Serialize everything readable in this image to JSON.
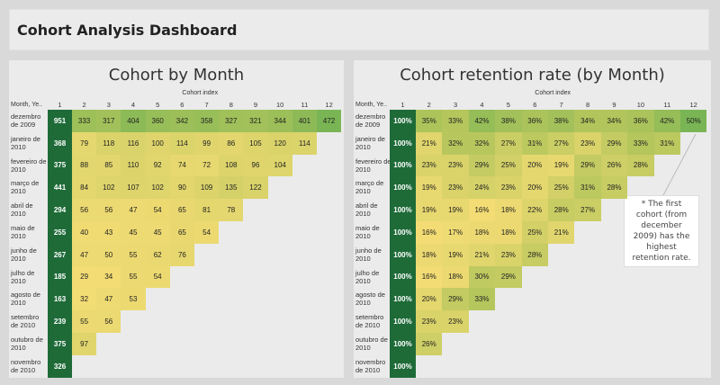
{
  "header": {
    "title": "Cohort Analysis Dashboard"
  },
  "colors": {
    "first_column": "#1e6b38",
    "high": "#7ab555",
    "mid_green": "#b4c65c",
    "low": "#f3dc74",
    "empty": "#ebebeb"
  },
  "axis": {
    "cohort_index_title": "Cohort index",
    "row_header": "Month, Ye..",
    "columns": [
      "1",
      "2",
      "3",
      "4",
      "5",
      "6",
      "7",
      "8",
      "9",
      "10",
      "11",
      "12"
    ]
  },
  "rows": [
    "dezembro de 2009",
    "janeiro de 2010",
    "fevereiro de 2010",
    "março de 2010",
    "abril de 2010",
    "maio de 2010",
    "junho de 2010",
    "julho de 2010",
    "agosto de 2010",
    "setembro de 2010",
    "outubro de 2010",
    "novembro de 2010"
  ],
  "left_panel": {
    "title": "Cohort by Month",
    "values": [
      [
        951,
        333,
        317,
        404,
        360,
        342,
        358,
        327,
        321,
        344,
        401,
        472
      ],
      [
        368,
        79,
        118,
        116,
        100,
        114,
        99,
        86,
        105,
        120,
        114
      ],
      [
        375,
        88,
        85,
        110,
        92,
        74,
        72,
        108,
        96,
        104
      ],
      [
        441,
        84,
        102,
        107,
        102,
        90,
        109,
        135,
        122
      ],
      [
        294,
        56,
        56,
        47,
        54,
        65,
        81,
        78
      ],
      [
        255,
        40,
        43,
        45,
        45,
        65,
        54
      ],
      [
        267,
        47,
        50,
        55,
        62,
        76
      ],
      [
        185,
        29,
        34,
        55,
        54
      ],
      [
        163,
        32,
        47,
        53
      ],
      [
        239,
        55,
        56
      ],
      [
        375,
        97
      ],
      [
        326
      ]
    ]
  },
  "right_panel": {
    "title": "Cohort retention rate (by Month)",
    "values": [
      [
        "100%",
        "35%",
        "33%",
        "42%",
        "38%",
        "36%",
        "38%",
        "34%",
        "34%",
        "36%",
        "42%",
        "50%"
      ],
      [
        "100%",
        "21%",
        "32%",
        "32%",
        "27%",
        "31%",
        "27%",
        "23%",
        "29%",
        "33%",
        "31%"
      ],
      [
        "100%",
        "23%",
        "23%",
        "29%",
        "25%",
        "20%",
        "19%",
        "29%",
        "26%",
        "28%"
      ],
      [
        "100%",
        "19%",
        "23%",
        "24%",
        "23%",
        "20%",
        "25%",
        "31%",
        "28%"
      ],
      [
        "100%",
        "19%",
        "19%",
        "16%",
        "18%",
        "22%",
        "28%",
        "27%"
      ],
      [
        "100%",
        "16%",
        "17%",
        "18%",
        "18%",
        "25%",
        "21%"
      ],
      [
        "100%",
        "18%",
        "19%",
        "21%",
        "23%",
        "28%"
      ],
      [
        "100%",
        "16%",
        "18%",
        "30%",
        "29%"
      ],
      [
        "100%",
        "20%",
        "29%",
        "33%"
      ],
      [
        "100%",
        "23%",
        "23%"
      ],
      [
        "100%",
        "26%"
      ],
      [
        "100%"
      ]
    ],
    "annotation": "* The first cohort (from december 2009) has the highest retention rate."
  }
}
